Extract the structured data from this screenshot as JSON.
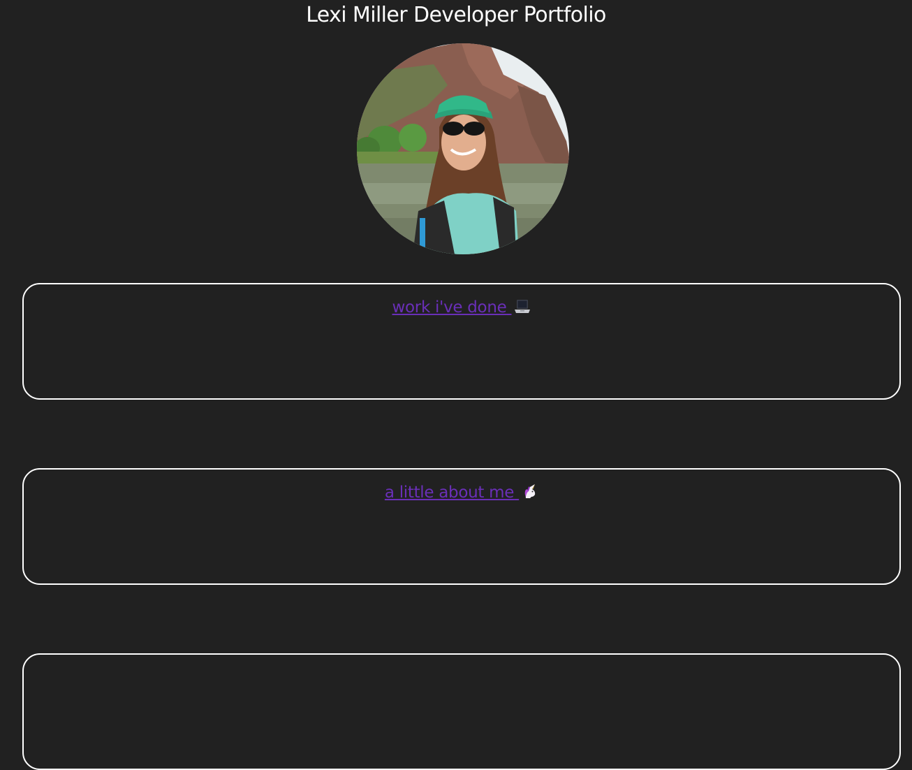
{
  "header": {
    "title": "Lexi Miller Developer Portfolio"
  },
  "avatar": {
    "icon": "profile-photo"
  },
  "sections": [
    {
      "label": "work i've done",
      "icon": "laptop-icon"
    },
    {
      "label": "a little about me",
      "icon": "unicorn-icon"
    },
    {
      "label": "",
      "icon": ""
    }
  ],
  "colors": {
    "background": "#212121",
    "link": "#6a2fb8",
    "border": "#ffffff",
    "text": "#ffffff"
  }
}
